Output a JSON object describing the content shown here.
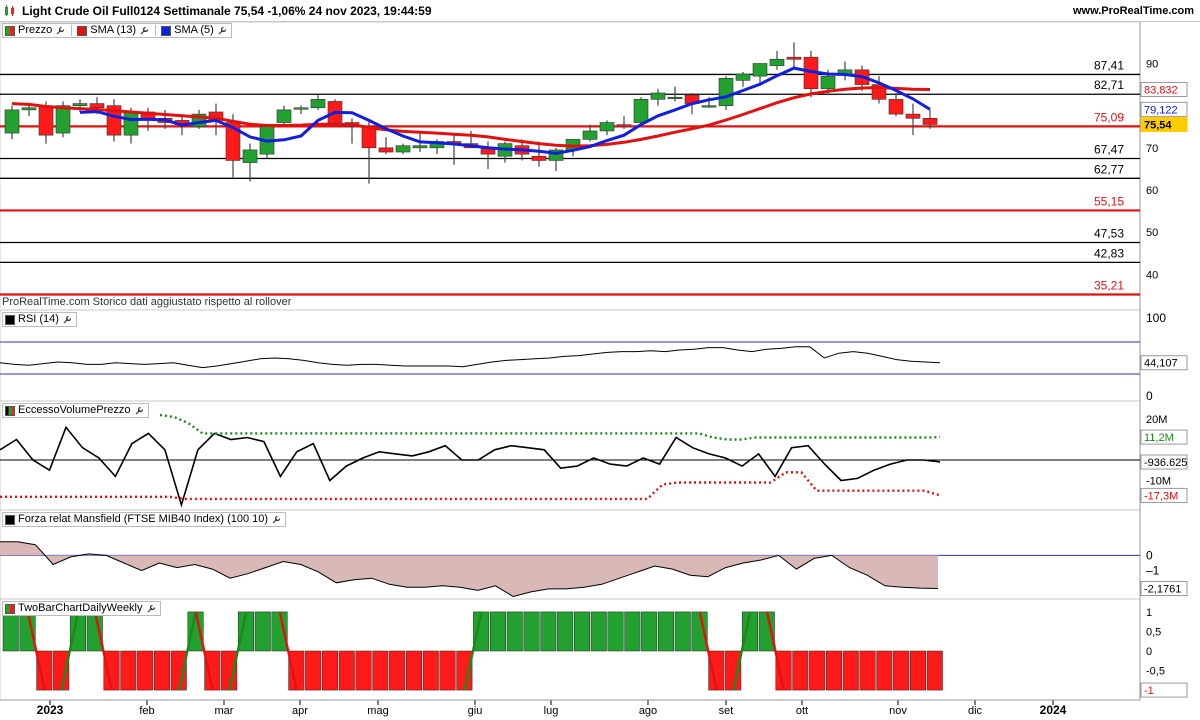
{
  "header": {
    "title": "Light Crude Oil Full0124 Settimanale 75,54 -1,06% 24 nov 2023, 19:44:59",
    "brand": "www.ProRealTime.com"
  },
  "panels": {
    "price": {
      "labels": [
        "Prezzo",
        "SMA (13)",
        "SMA (5)"
      ],
      "note": "ProRealTime.com  Storico dati aggiustato rispetto al rollover"
    },
    "rsi": {
      "label": "RSI (14)"
    },
    "eccesso": {
      "label": "EccessoVolumePrezzo"
    },
    "mansfield": {
      "label": "Forza relat Mansfield (FTSE MIB40 Index) (100 10)"
    },
    "twobar": {
      "label": "TwoBarChartDailyWeekly"
    }
  },
  "colors": {
    "up": "#22a030",
    "down": "#ff1a1a",
    "sma13": "#e31010",
    "sma5": "#1020dd",
    "grid": "#000000"
  },
  "chart_data": [
    {
      "type": "candlestick",
      "title": "Light Crude Oil Full0124 Settimanale",
      "ylim": [
        32,
        97
      ],
      "yticks": [
        40,
        50,
        60,
        70,
        80,
        90
      ],
      "x_months": [
        "2023",
        "feb",
        "mar",
        "apr",
        "mag",
        "giu",
        "lug",
        "ago",
        "set",
        "ott",
        "nov",
        "dic",
        "2024"
      ],
      "horizontal_lines": [
        {
          "value": 87.41,
          "label": "87,41",
          "color": "#000000"
        },
        {
          "value": 82.71,
          "label": "82,71",
          "color": "#000000"
        },
        {
          "value": 75.09,
          "label": "75,09",
          "color": "#e31010"
        },
        {
          "value": 67.47,
          "label": "67,47",
          "color": "#000000"
        },
        {
          "value": 62.77,
          "label": "62,77",
          "color": "#000000"
        },
        {
          "value": 55.15,
          "label": "55,15",
          "color": "#e31010"
        },
        {
          "value": 47.53,
          "label": "47,53",
          "color": "#000000"
        },
        {
          "value": 42.83,
          "label": "42,83",
          "color": "#000000"
        },
        {
          "value": 35.21,
          "label": "35,21",
          "color": "#e31010"
        }
      ],
      "candles": [
        [
          73.5,
          80.0,
          72.0,
          79.0
        ],
        [
          79.0,
          80.5,
          77.5,
          79.5
        ],
        [
          80.0,
          81.0,
          71.0,
          73.0
        ],
        [
          73.5,
          81.0,
          72.5,
          80.0
        ],
        [
          80.0,
          81.5,
          78.5,
          80.5
        ],
        [
          80.5,
          82.0,
          78.0,
          79.5
        ],
        [
          80.0,
          81.5,
          71.5,
          73.0
        ],
        [
          73.0,
          79.5,
          71.0,
          78.5
        ],
        [
          78.5,
          79.5,
          74.0,
          77.0
        ],
        [
          77.0,
          79.0,
          74.5,
          76.0
        ],
        [
          76.5,
          78.0,
          73.0,
          75.5
        ],
        [
          75.0,
          79.0,
          74.5,
          78.0
        ],
        [
          78.5,
          80.5,
          73.0,
          76.5
        ],
        [
          76.0,
          78.0,
          63.0,
          67.0
        ],
        [
          66.5,
          71.0,
          62.0,
          69.5
        ],
        [
          68.5,
          75.5,
          67.5,
          75.0
        ],
        [
          76.0,
          80.0,
          75.5,
          79.0
        ],
        [
          79.5,
          80.0,
          78.0,
          79.5
        ],
        [
          79.5,
          82.5,
          79.0,
          81.5
        ],
        [
          81.0,
          81.5,
          75.5,
          76.0
        ],
        [
          76.0,
          77.0,
          71.0,
          75.0
        ],
        [
          75.0,
          76.5,
          61.5,
          70.0
        ],
        [
          70.0,
          72.5,
          68.5,
          69.0
        ],
        [
          69.0,
          71.0,
          68.5,
          70.5
        ],
        [
          70.0,
          73.5,
          69.0,
          70.5
        ],
        [
          70.0,
          72.0,
          68.5,
          71.5
        ],
        [
          71.5,
          73.0,
          66.0,
          71.0
        ],
        [
          71.0,
          74.0,
          70.0,
          70.0
        ],
        [
          70.0,
          71.5,
          65.0,
          68.5
        ],
        [
          68.0,
          71.5,
          66.5,
          71.0
        ],
        [
          70.5,
          72.0,
          67.0,
          68.5
        ],
        [
          68.0,
          71.5,
          65.5,
          67.0
        ],
        [
          67.0,
          70.0,
          64.5,
          69.5
        ],
        [
          69.5,
          72.0,
          68.0,
          72.0
        ],
        [
          72.0,
          75.5,
          71.5,
          74.0
        ],
        [
          74.0,
          76.5,
          73.0,
          76.0
        ],
        [
          75.5,
          77.5,
          74.5,
          75.0
        ],
        [
          76.0,
          82.0,
          75.0,
          81.5
        ],
        [
          81.5,
          84.0,
          80.0,
          83.0
        ],
        [
          82.0,
          84.5,
          81.0,
          82.0
        ],
        [
          82.5,
          83.0,
          78.0,
          80.5
        ],
        [
          80.0,
          82.0,
          79.5,
          80.0
        ],
        [
          80.0,
          87.0,
          79.0,
          86.5
        ],
        [
          86.0,
          88.0,
          84.5,
          87.5
        ],
        [
          87.0,
          89.5,
          85.5,
          90.0
        ],
        [
          89.5,
          93.0,
          88.5,
          91.0
        ],
        [
          91.5,
          95.0,
          89.0,
          91.0
        ],
        [
          91.5,
          93.0,
          82.0,
          84.0
        ],
        [
          84.0,
          88.5,
          82.5,
          87.0
        ],
        [
          87.5,
          90.5,
          86.0,
          88.5
        ],
        [
          88.5,
          89.5,
          83.5,
          85.0
        ],
        [
          85.0,
          87.0,
          80.5,
          81.5
        ],
        [
          81.5,
          83.0,
          77.5,
          78.0
        ],
        [
          78.0,
          80.5,
          73.0,
          77.0
        ],
        [
          77.0,
          79.0,
          74.5,
          75.54
        ]
      ]
    },
    {
      "type": "line",
      "name": "SMA (13)",
      "last_label": "83,832",
      "values": [
        80.5,
        80.3,
        79.8,
        79.5,
        79.3,
        79.1,
        78.8,
        78.5,
        78.2,
        77.9,
        77.6,
        77.3,
        77.0,
        76.3,
        75.6,
        75.3,
        75.3,
        75.4,
        75.6,
        75.6,
        75.5,
        74.8,
        74.3,
        73.9,
        73.7,
        73.5,
        73.2,
        73.0,
        72.6,
        72.0,
        71.5,
        71.0,
        70.6,
        70.4,
        70.5,
        70.8,
        71.3,
        72.0,
        72.8,
        73.7,
        74.5,
        75.4,
        76.6,
        77.9,
        79.3,
        80.7,
        81.9,
        82.8,
        83.4,
        83.9,
        84.2,
        84.3,
        84.1,
        83.9,
        83.832
      ]
    },
    {
      "type": "line",
      "name": "SMA (5)",
      "last_label": "79,122",
      "values": [
        null,
        null,
        null,
        null,
        78.4,
        78.6,
        77.5,
        76.7,
        76.8,
        76.6,
        75.4,
        76.0,
        76.5,
        74.8,
        72.6,
        71.6,
        71.9,
        72.8,
        76.5,
        78.4,
        78.3,
        76.5,
        74.5,
        72.8,
        71.4,
        71.2,
        70.9,
        70.5,
        70.0,
        69.7,
        69.5,
        69.2,
        68.7,
        69.4,
        70.3,
        71.7,
        73.0,
        75.5,
        77.6,
        79.0,
        80.5,
        81.4,
        82.1,
        83.6,
        85.1,
        87.1,
        88.9,
        88.1,
        87.5,
        87.4,
        86.9,
        85.4,
        83.6,
        81.6,
        79.122
      ],
      "price_label": "75,54"
    },
    {
      "type": "line",
      "name": "RSI (14)",
      "ylim": [
        0,
        100
      ],
      "yticks": [
        0,
        100
      ],
      "bands": [
        30,
        70
      ],
      "last_label": "44,107",
      "values": [
        44,
        42,
        41,
        43,
        45,
        44,
        42,
        42,
        44,
        43,
        42,
        43,
        44,
        41,
        38,
        40,
        43,
        46,
        49,
        50,
        49,
        47,
        44,
        42,
        41,
        42,
        42,
        41,
        40,
        40,
        40,
        40,
        39,
        42,
        45,
        47,
        48,
        49,
        50,
        52,
        53,
        55,
        57,
        58,
        58,
        59,
        58,
        60,
        61,
        63,
        63,
        60,
        58,
        61,
        62,
        64,
        64,
        50,
        56,
        58,
        56,
        52,
        48,
        46,
        45,
        44.107
      ]
    },
    {
      "type": "line",
      "name": "EccessoVolumePrezzo",
      "ylim": [
        -22,
        22
      ],
      "yticks": [
        20,
        -10
      ],
      "ytick_labels": [
        "20M",
        "-10M"
      ],
      "labels": [
        "11,2M",
        "-936.625",
        "-17,3M"
      ],
      "values": [
        5,
        10,
        0,
        -5,
        16,
        6,
        1,
        -8,
        8,
        13,
        5,
        -22,
        5,
        13,
        10,
        11,
        9,
        -8,
        4,
        8,
        -10,
        -3,
        1,
        4,
        3,
        2,
        4,
        7,
        0,
        0,
        5,
        7,
        6,
        5,
        -4,
        -3,
        1,
        -2,
        -3,
        1,
        -2,
        11,
        6,
        3,
        1,
        -3,
        3,
        -8,
        6,
        7,
        -2,
        -10,
        -9,
        -5,
        -2,
        0,
        0,
        -0.94
      ],
      "upper_band": [
        22,
        21,
        18,
        13,
        13,
        13,
        13,
        13,
        13,
        13,
        13,
        13,
        13,
        13,
        13,
        13,
        13,
        13,
        13,
        13,
        13,
        13,
        13,
        13,
        13,
        13,
        13,
        13,
        13,
        13,
        13,
        13,
        13,
        13,
        13,
        13,
        13,
        13,
        13,
        11,
        10,
        10,
        11,
        11,
        11,
        11,
        11,
        11,
        11,
        11,
        11,
        11,
        11,
        11,
        11,
        11.2
      ],
      "lower_band": [
        -18,
        -18,
        -18,
        -18,
        -18,
        -18,
        -18,
        -18,
        -18,
        -18,
        -18,
        -18,
        -19,
        -19,
        -19,
        -19,
        -19,
        -19,
        -19,
        -19,
        -19,
        -19,
        -19,
        -19,
        -19,
        -19,
        -19,
        -19,
        -19,
        -19,
        -19,
        -19,
        -19,
        -19,
        -19,
        -19,
        -19,
        -19,
        -19,
        -19,
        -19,
        -19,
        -19,
        -12,
        -11,
        -11,
        -11,
        -11,
        -11,
        -11,
        -11,
        -6,
        -6,
        -15,
        -15,
        -15,
        -15,
        -15,
        -15,
        -15,
        -15,
        -17.3
      ]
    },
    {
      "type": "area",
      "name": "Forza relat Mansfield (FTSE MIB40 Index) (100 10)",
      "ylim": [
        -2.8,
        1.8
      ],
      "yticks": [
        0,
        -1
      ],
      "last_label": "-2,1761",
      "values": [
        0.9,
        0.9,
        0.7,
        -0.6,
        -0.1,
        0.1,
        0.0,
        -0.5,
        -1.0,
        -0.5,
        -0.8,
        -0.6,
        -0.9,
        -1.5,
        -1.2,
        -0.8,
        -0.4,
        -0.6,
        -1.1,
        -1.8,
        -1.6,
        -1.5,
        -1.9,
        -2.1,
        -2.1,
        -2.0,
        -2.1,
        -2.3,
        -2.0,
        -2.7,
        -2.4,
        -2.2,
        -2.2,
        -2.1,
        -1.9,
        -1.5,
        -1.1,
        -0.7,
        -0.9,
        -1.3,
        -1.4,
        -0.8,
        -0.5,
        -0.3,
        0.0,
        -0.9,
        -0.2,
        0.0,
        -0.8,
        -1.3,
        -2.0,
        -2.1,
        -2.15,
        -2.1761
      ]
    },
    {
      "type": "bar",
      "name": "TwoBarChartDailyWeekly",
      "ylim": [
        -1.1,
        1.1
      ],
      "yticks": [
        1,
        0.5,
        0,
        -0.5,
        -1
      ],
      "ytick_labels": [
        "1",
        "0,5",
        "0",
        "-0,5",
        "-1"
      ],
      "last_label": "-1",
      "values": [
        1,
        1,
        -1,
        -1,
        1,
        1,
        -1,
        -1,
        -1,
        -1,
        -1,
        1,
        -1,
        -1,
        1,
        1,
        1,
        -1,
        -1,
        -1,
        -1,
        -1,
        -1,
        -1,
        -1,
        -1,
        -1,
        -1,
        1,
        1,
        1,
        1,
        1,
        1,
        1,
        1,
        1,
        1,
        1,
        1,
        1,
        1,
        -1,
        -1,
        1,
        1,
        -1,
        -1,
        -1,
        -1,
        -1,
        -1,
        -1,
        -1,
        -1,
        -1
      ]
    }
  ]
}
